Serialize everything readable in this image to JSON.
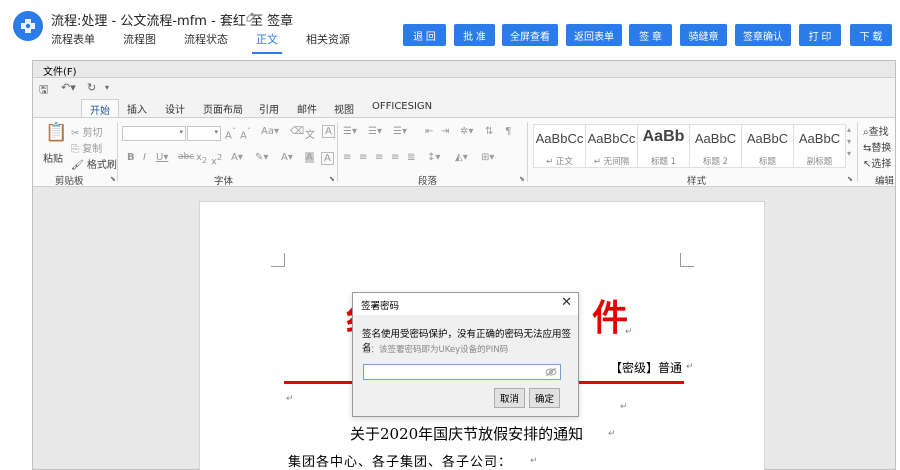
{
  "header": {
    "title": "流程:处理 - 公文流程-mfm - 套红 至 签章",
    "tabs": [
      {
        "label": "流程表单"
      },
      {
        "label": "流程图"
      },
      {
        "label": "流程状态"
      },
      {
        "label": "正文",
        "active": true
      },
      {
        "label": "相关资源"
      }
    ],
    "actions": [
      {
        "label": "退 回"
      },
      {
        "label": "批 准"
      },
      {
        "label": "全屏查看"
      },
      {
        "label": "返回表单"
      },
      {
        "label": "签 章"
      },
      {
        "label": "骑缝章"
      },
      {
        "label": "签章确认"
      },
      {
        "label": "打 印"
      },
      {
        "label": "下 载"
      }
    ],
    "accent_color": "#2b7ce9"
  },
  "document_editor": {
    "file_menu": "文件(F)",
    "ribbon_tabs": [
      {
        "label": "开始",
        "active": true
      },
      {
        "label": "插入"
      },
      {
        "label": "设计"
      },
      {
        "label": "页面布局"
      },
      {
        "label": "引用"
      },
      {
        "label": "邮件"
      },
      {
        "label": "视图"
      },
      {
        "label": "OFFICESIGN"
      }
    ],
    "clipboard": {
      "paste": "粘贴",
      "cut": "剪切",
      "copy": "复制",
      "format_painter": "格式刷",
      "label": "剪贴板"
    },
    "font_group_label": "字体",
    "paragraph_group_label": "段落",
    "styles": {
      "items": [
        {
          "sample": "AaBbCc",
          "name": "↵ 正文"
        },
        {
          "sample": "AaBbCc",
          "name": "↵ 无间隔"
        },
        {
          "sample": "AaBb",
          "name": "标题 1"
        },
        {
          "sample": "AaBbC",
          "name": "标题 2"
        },
        {
          "sample": "AaBbC",
          "name": "标题"
        },
        {
          "sample": "AaBbC",
          "name": "副标题"
        }
      ],
      "label": "样式"
    },
    "editing": {
      "find": "查找",
      "replace": "替换",
      "select": "选择",
      "label": "编辑"
    }
  },
  "document": {
    "heading_left": "纟",
    "heading_right": "件",
    "secret_level": "【密级】普通",
    "title": "关于2020年国庆节放假安排的通知",
    "greeting": "集团各中心、各子集团、各子公司：",
    "heading_color": "#e60000"
  },
  "dialog": {
    "title": "签署密码",
    "message": "签名使用受密码保护，没有正确的密码无法应用签名",
    "note": "注：该签署密码即为UKey设备的PIN码",
    "password_value": "",
    "cancel_label": "取消",
    "ok_label": "确定"
  }
}
